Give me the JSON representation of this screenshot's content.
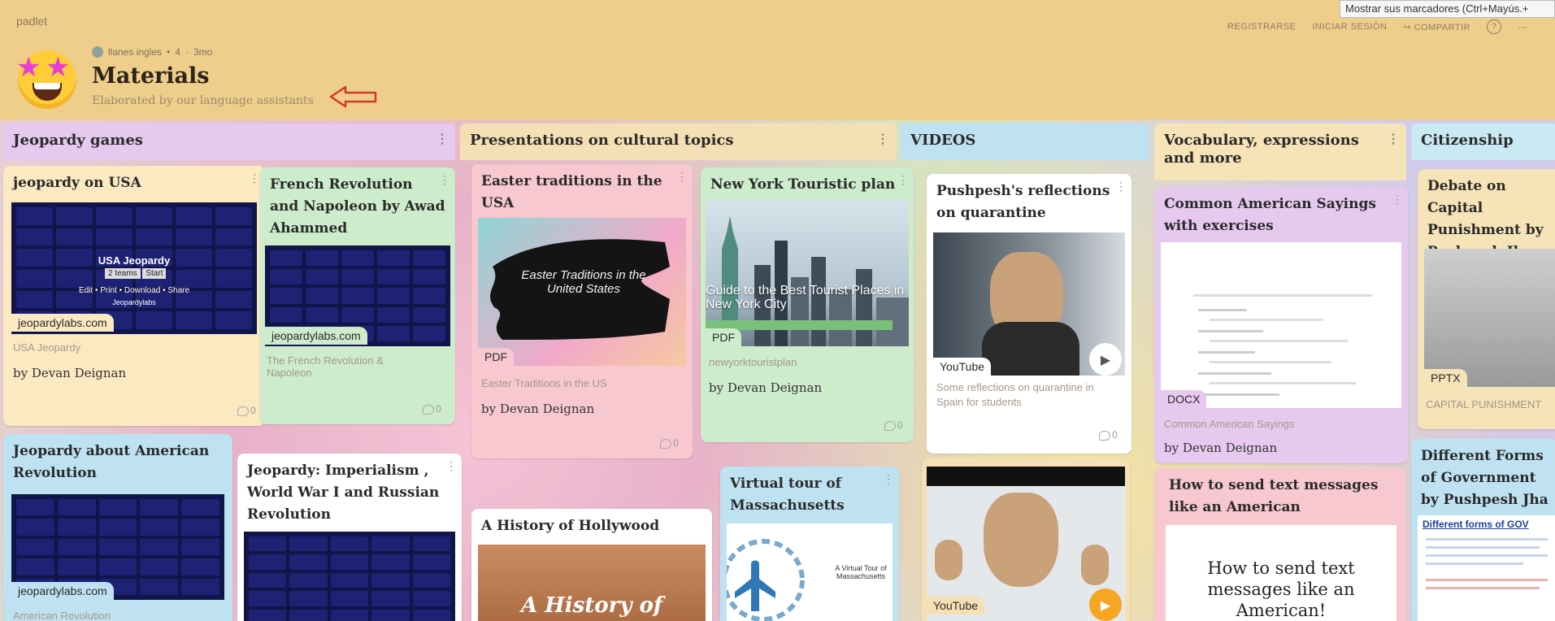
{
  "app": {
    "brand": "padlet",
    "title": "Materials",
    "description": "Elaborated by our language assistants",
    "meta": {
      "author": "llanes ingles",
      "dot": "•",
      "count": "4",
      "sep": "·",
      "age": "3mo"
    }
  },
  "tooltip": "Mostrar sus marcadores (Ctrl+Mayús.+",
  "nav": {
    "register": "REGISTRARSE",
    "login": "INICIAR SESIÓN",
    "share_icon": "↪",
    "share": "COMPARTIR",
    "help_icon": "?",
    "more": "⋯"
  },
  "columns": [
    {
      "title": "Jeopardy games",
      "color": "#e5c9ef"
    },
    {
      "title": "Presentations on cultural topics",
      "color": "#f5e0b5"
    },
    {
      "title": "VIDEOS",
      "color": "#bfe2f2"
    },
    {
      "title": "Vocabulary, expressions and more",
      "color": "#f6e3b8"
    },
    {
      "title": "Citizenship",
      "color": "#c9e9f3"
    }
  ],
  "cards": {
    "c1": {
      "title": "jeopardy on USA",
      "thumb_title": "USA Jeopardy",
      "thumb_teams": "2 teams",
      "thumb_start": "Start",
      "thumb_links": "Edit • Print • Download • Share",
      "thumb_links2": "Jeopardylabs",
      "badge": "jeopardylabs.com",
      "sub": "USA Jeopardy",
      "by": "by Devan Deignan",
      "comments": "0"
    },
    "c2": {
      "title": "French Revolution and Napoleon by Awad Ahammed",
      "badge": "jeopardylabs.com",
      "sub": "The French Revolution & Napoleon",
      "comments": "0"
    },
    "c3": {
      "title": "Jeopardy about American Revolution",
      "badge": "jeopardylabs.com",
      "sub": "American Revolution"
    },
    "c4": {
      "title": "Jeopardy: Imperialism , World War I and Russian Revolution"
    },
    "c5": {
      "title": "Easter traditions in the USA",
      "thumb_text": "Easter Traditions in the United States",
      "badge": "PDF",
      "sub": "Easter Traditions in the US",
      "by": "by Devan Deignan",
      "comments": "0"
    },
    "c6": {
      "title": "New York Touristic plan",
      "thumb_text": "Guide to the Best Tourist Places in New York City",
      "badge": "PDF",
      "sub": "newyorktouristplan",
      "by": "by Devan Deignan",
      "comments": "0"
    },
    "c7": {
      "title": "A History of Hollywood",
      "thumb_text": "A History of"
    },
    "c8": {
      "title": "Virtual tour of Massachusetts",
      "thumb_text": "A Virtual Tour of Massachusetts"
    },
    "c9": {
      "title": "Pushpesh's reflections on quarantine",
      "badge": "YouTube",
      "sub": "Some reflections on quarantine in Spain for students",
      "comments": "0"
    },
    "c10": {
      "badge": "YouTube"
    },
    "c11": {
      "title": "Common American Sayings with exercises",
      "badge": "DOCX",
      "sub": "Common American Sayings",
      "by": "by Devan Deignan"
    },
    "c12": {
      "title": "How to send text messages like an American",
      "thumb_text": "How to send text messages like an American!"
    },
    "c13": {
      "title": "Debate on Capital Punishment by Pushpesh Jha",
      "badge": "PPTX",
      "sub": "CAPITAL PUNISHMENT"
    },
    "c14": {
      "title": "Different Forms of Government by Pushpesh Jha",
      "thumb_text": "Different forms of GOV"
    }
  }
}
